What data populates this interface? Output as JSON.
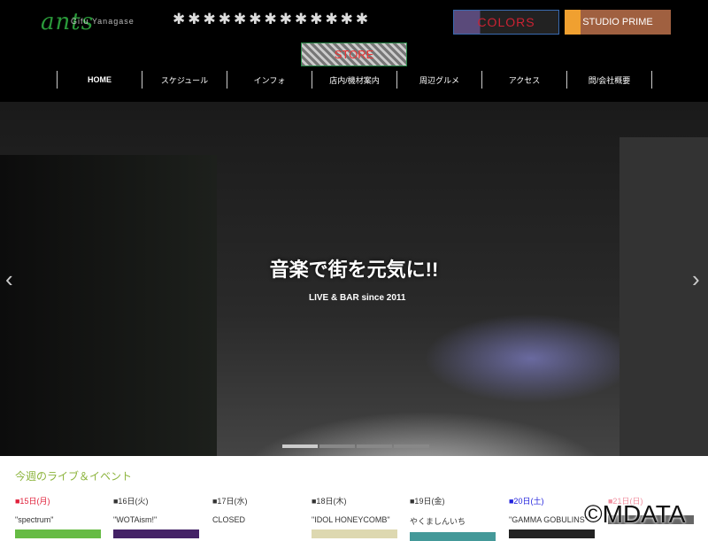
{
  "header": {
    "logo": "ants",
    "logo_sub": "Gifu Yanagase",
    "ants_decoration": "✱✱✱✱✱✱✱✱✱✱✱✱✱",
    "banners": {
      "colors": "COLORS",
      "studio_prime": "STUDIO PRIME",
      "store": "STORE"
    }
  },
  "nav": [
    "HOME",
    "スケジュール",
    "インフォ",
    "店内/機材案内",
    "周辺グルメ",
    "アクセス",
    "問/会社概要"
  ],
  "hero": {
    "title": "音楽で街を元気に!!",
    "subtitle": "LIVE & BAR since 2011",
    "prev": "‹",
    "next": "›",
    "slides": 4,
    "active_slide": 1
  },
  "events": {
    "title": "今週のライブ＆イベント",
    "days": [
      {
        "date": "■15日(月)",
        "title": "\"spectrum\"",
        "color": "#e0203a",
        "img": "#66bb44"
      },
      {
        "date": "■16日(火)",
        "title": "\"WOTAism!\"",
        "color": "#333333",
        "img": "#442266"
      },
      {
        "date": "■17日(水)",
        "title": "CLOSED",
        "color": "#333333",
        "img": ""
      },
      {
        "date": "■18日(木)",
        "title": "\"IDOL HONEYCOMB\"",
        "color": "#333333",
        "img": "#ddd8b0"
      },
      {
        "date": "■19日(金)",
        "title": "やくましんいち",
        "color": "#333333",
        "img": "#449999"
      },
      {
        "date": "■20日(土)",
        "title": "\"GAMMA GOBULINS\"",
        "color": "#2222dd",
        "img": "#222222"
      },
      {
        "date": "■21日(日)",
        "title": "",
        "color": "#f090a0",
        "img": "#666666"
      }
    ]
  },
  "watermark": "©MDATA"
}
